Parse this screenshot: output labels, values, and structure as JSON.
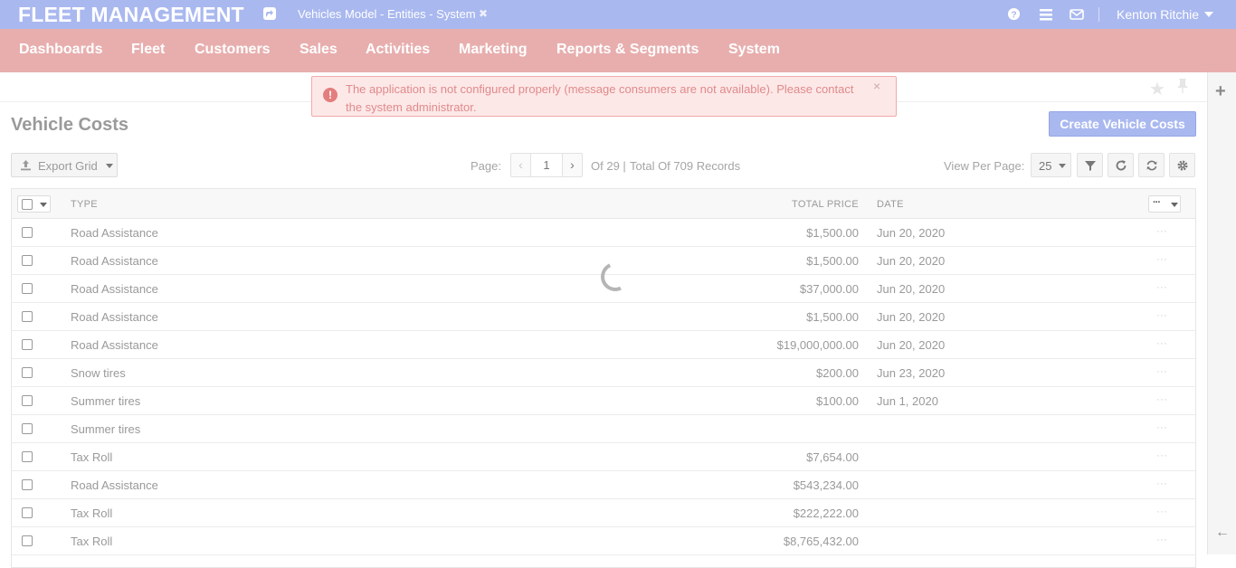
{
  "app": {
    "brand": "FLEET MANAGEMENT",
    "context_title": "Vehicles Model - Entities - System",
    "context_close": "✖",
    "user_name": "Kenton Ritchie",
    "icons": [
      "share-icon",
      "help-icon",
      "list-icon",
      "envelope-icon"
    ]
  },
  "menu": {
    "items": [
      "Dashboards",
      "Fleet",
      "Customers",
      "Sales",
      "Activities",
      "Marketing",
      "Reports & Segments",
      "System"
    ]
  },
  "alert": {
    "icon": "!",
    "text": "The application is not configured properly (message consumers are not available). Please contact the system administrator.",
    "close": "×"
  },
  "page": {
    "title": "Vehicle Costs",
    "create_label": "Create Vehicle Costs"
  },
  "toolbar": {
    "export_label": "Export Grid",
    "page_label": "Page:",
    "current_page": "1",
    "page_of": "Of 29 |",
    "total_records": "Total Of 709 Records",
    "view_per_page_label": "View Per Page:",
    "per_page_value": "25"
  },
  "grid": {
    "columns": [
      "TYPE",
      "TOTAL PRICE",
      "DATE"
    ],
    "actions_label": "···",
    "rows": [
      {
        "type": "Road Assistance",
        "price": "$1,500.00",
        "date": "Jun 20, 2020"
      },
      {
        "type": "Road Assistance",
        "price": "$1,500.00",
        "date": "Jun 20, 2020"
      },
      {
        "type": "Road Assistance",
        "price": "$37,000.00",
        "date": "Jun 20, 2020"
      },
      {
        "type": "Road Assistance",
        "price": "$1,500.00",
        "date": "Jun 20, 2020"
      },
      {
        "type": "Road Assistance",
        "price": "$19,000,000.00",
        "date": "Jun 20, 2020"
      },
      {
        "type": "Snow tires",
        "price": "$200.00",
        "date": "Jun 23, 2020"
      },
      {
        "type": "Summer tires",
        "price": "$100.00",
        "date": "Jun 1, 2020"
      },
      {
        "type": "Summer tires",
        "price": "",
        "date": ""
      },
      {
        "type": "Tax Roll",
        "price": "$7,654.00",
        "date": ""
      },
      {
        "type": "Road Assistance",
        "price": "$543,234.00",
        "date": ""
      },
      {
        "type": "Tax Roll",
        "price": "$222,222.00",
        "date": ""
      },
      {
        "type": "Tax Roll",
        "price": "$8,765,432.00",
        "date": ""
      }
    ],
    "row_action": "···"
  },
  "colors": {
    "topbar": "#a9b8ef",
    "menubar": "#e8aeae",
    "alert_bg": "#fde8e8",
    "primary_button": "#a9b8ef"
  }
}
